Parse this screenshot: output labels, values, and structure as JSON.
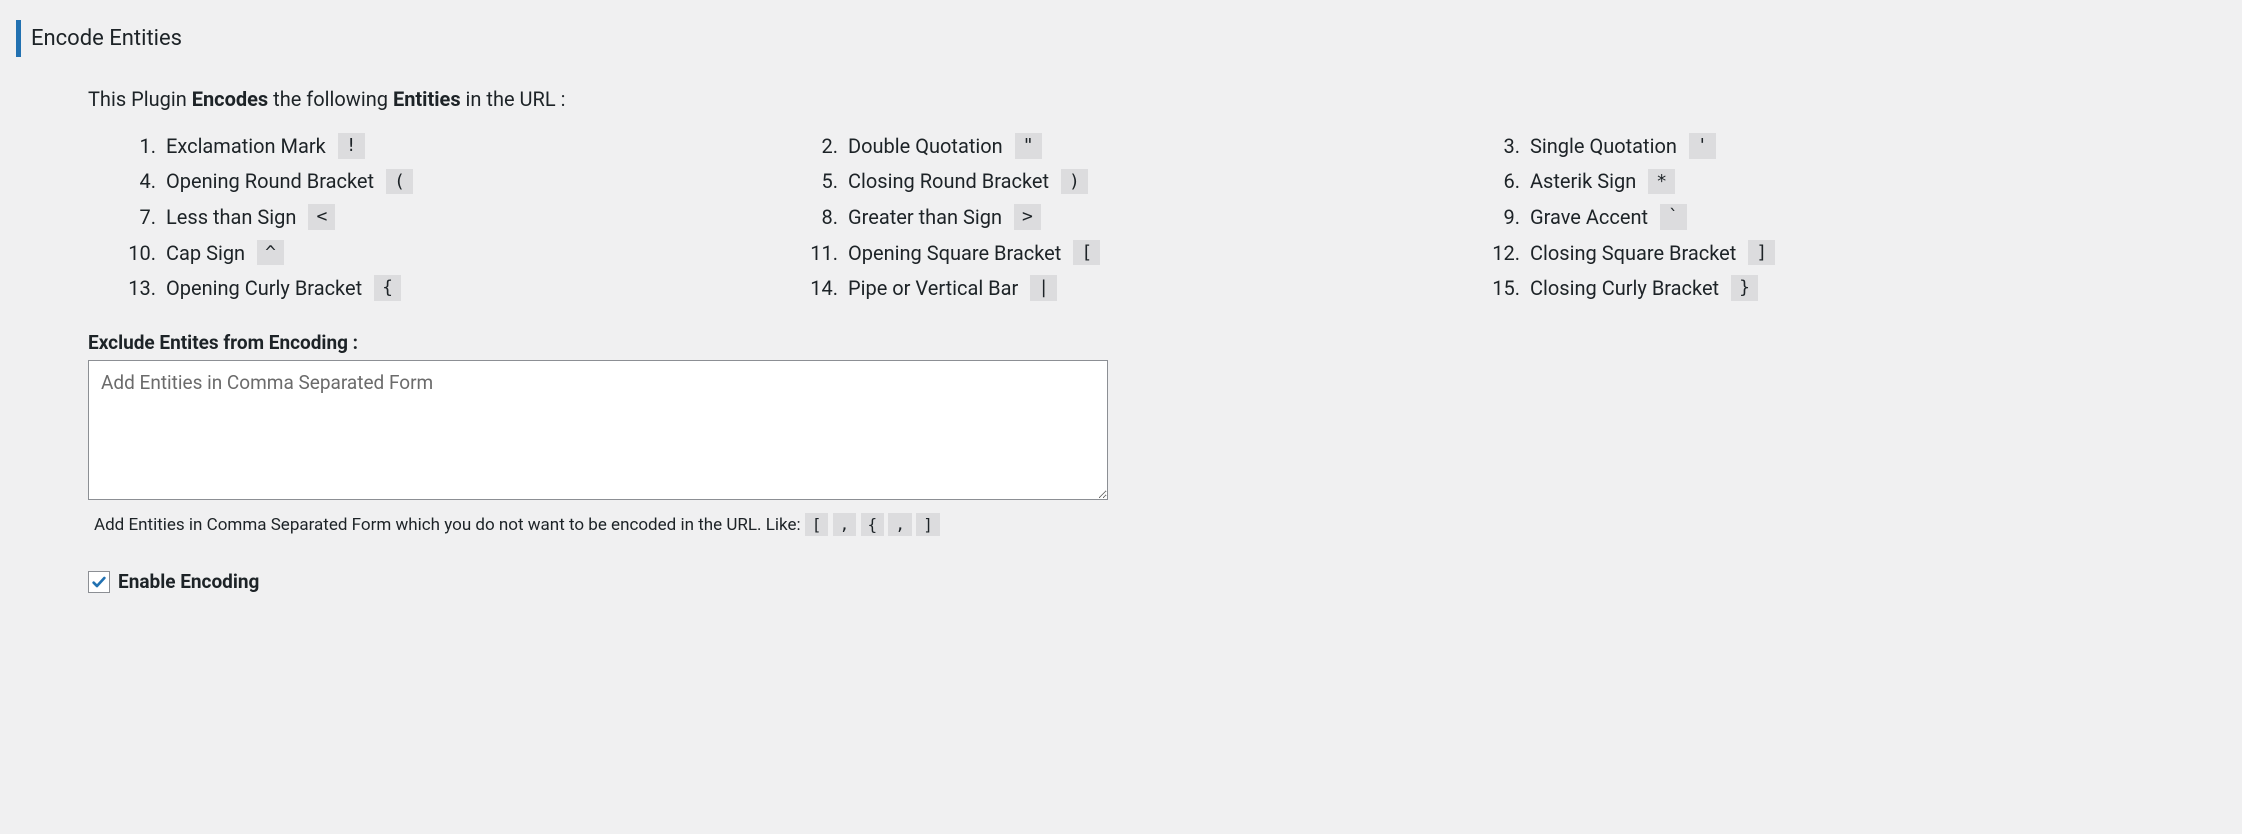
{
  "heading": "Encode Entities",
  "intro": {
    "prefix": "This Plugin ",
    "bold1": "Encodes",
    "mid": " the following ",
    "bold2": "Entities",
    "suffix": " in the URL :"
  },
  "entities": [
    {
      "num": "1.",
      "label": "Exclamation Mark",
      "sym": "!"
    },
    {
      "num": "2.",
      "label": "Double Quotation",
      "sym": "\""
    },
    {
      "num": "3.",
      "label": "Single Quotation",
      "sym": "'"
    },
    {
      "num": "4.",
      "label": "Opening Round Bracket",
      "sym": "("
    },
    {
      "num": "5.",
      "label": "Closing Round Bracket",
      "sym": ")"
    },
    {
      "num": "6.",
      "label": "Asterik Sign",
      "sym": "*"
    },
    {
      "num": "7.",
      "label": "Less than Sign",
      "sym": "<"
    },
    {
      "num": "8.",
      "label": "Greater than Sign",
      "sym": ">"
    },
    {
      "num": "9.",
      "label": "Grave Accent",
      "sym": "`"
    },
    {
      "num": "10.",
      "label": "Cap Sign",
      "sym": "^"
    },
    {
      "num": "11.",
      "label": "Opening Square Bracket",
      "sym": "["
    },
    {
      "num": "12.",
      "label": "Closing Square Bracket",
      "sym": "]"
    },
    {
      "num": "13.",
      "label": "Opening Curly Bracket",
      "sym": "{"
    },
    {
      "num": "14.",
      "label": "Pipe or Vertical Bar",
      "sym": "|"
    },
    {
      "num": "15.",
      "label": "Closing Curly Bracket",
      "sym": "}"
    }
  ],
  "exclude": {
    "label": "Exclude Entites from Encoding :",
    "placeholder": "Add Entities in Comma Separated Form",
    "value": "",
    "help_prefix": "Add Entities in Comma Separated Form which you do not want to be encoded in the URL. Like: ",
    "help_examples": [
      "[",
      ",",
      "{",
      ",",
      "]"
    ]
  },
  "enable": {
    "label": "Enable Encoding",
    "checked": true
  }
}
